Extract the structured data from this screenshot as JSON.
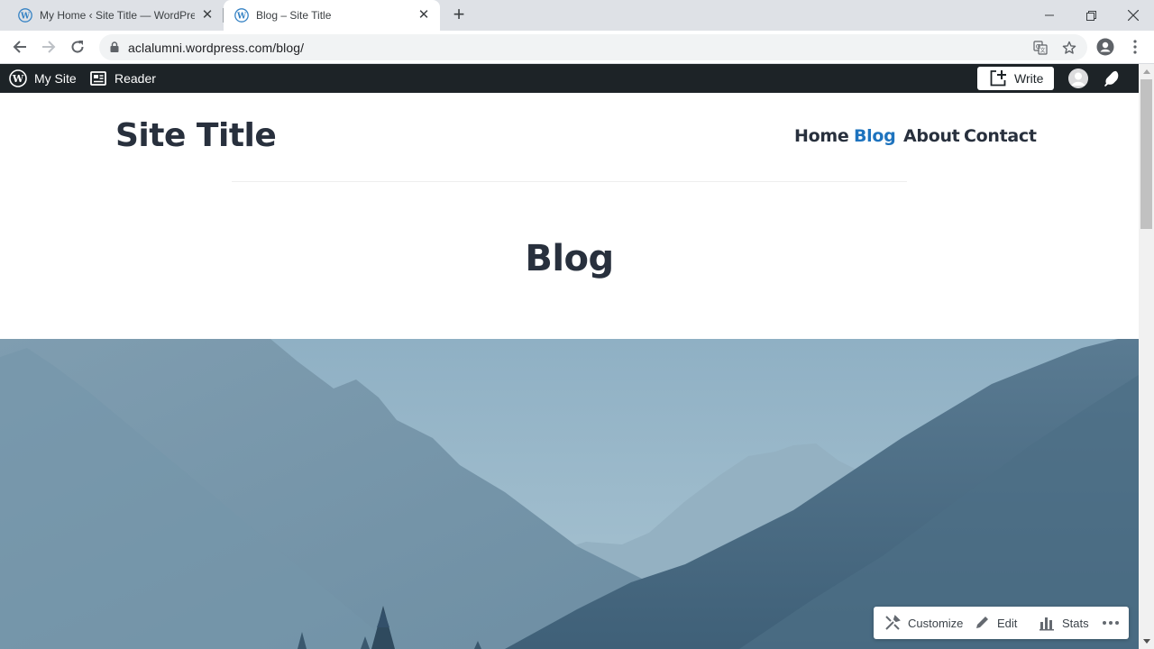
{
  "browser": {
    "tabs": [
      {
        "title": "My Home ‹ Site Title — WordPress.com",
        "active": false
      },
      {
        "title": "Blog – Site Title",
        "active": true
      }
    ],
    "url": "aclalumni.wordpress.com/blog/"
  },
  "adminbar": {
    "my_site": "My Site",
    "reader": "Reader",
    "write": "Write"
  },
  "site": {
    "title": "Site Title",
    "nav": [
      {
        "label": "Home",
        "current": false
      },
      {
        "label": "Blog",
        "current": true
      },
      {
        "label": "About",
        "current": false
      },
      {
        "label": "Contact",
        "current": false
      }
    ],
    "page_title": "Blog"
  },
  "actions": {
    "customize": "Customize",
    "edit": "Edit",
    "stats": "Stats"
  },
  "colors": {
    "adminbar_bg": "#1d2327",
    "link_current": "#1e73be",
    "text": "#28303d"
  }
}
